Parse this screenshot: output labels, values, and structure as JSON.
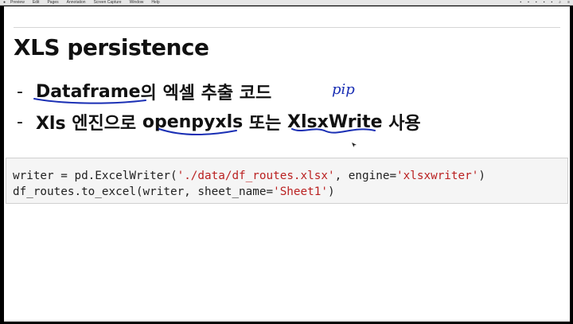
{
  "menubar": {
    "app": "Preview",
    "items": [
      "Edit",
      "Pages",
      "Annotation",
      "Screen Capture",
      "Window",
      "Help"
    ]
  },
  "slide": {
    "title": "XLS persistence",
    "bullets": [
      {
        "dash": "-",
        "parts": [
          "Dataframe",
          "의 엑셀 추출 코드"
        ]
      },
      {
        "dash": "-",
        "parts": [
          "Xls 엔진으로 ",
          "openpyxls",
          " 또는 ",
          "XlsxWrite",
          " 사용"
        ]
      }
    ],
    "handwriting": "pip"
  },
  "code": {
    "line1": {
      "a": "writer = pd.ExcelWriter(",
      "s1": "'./data/df_routes.xlsx'",
      "b": ", engine=",
      "s2": "'xlsxwriter'",
      "c": ")"
    },
    "line2": {
      "a": "df_routes.to_excel(writer, sheet_name=",
      "s1": "'Sheet1'",
      "b": ")"
    }
  },
  "colors": {
    "ink": "#1a2fb4",
    "string": "#ba2121",
    "code_bg": "#f5f5f5"
  }
}
